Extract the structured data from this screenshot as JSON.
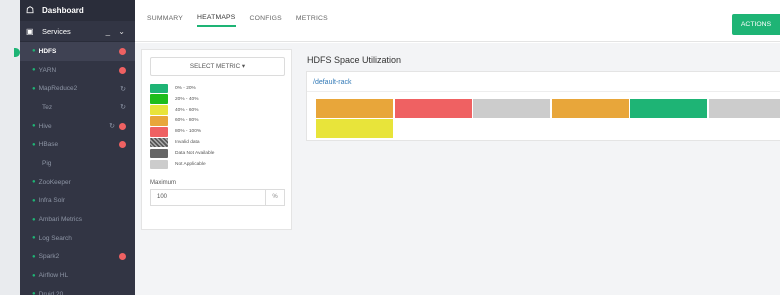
{
  "sidebar": {
    "dashboard": "Dashboard",
    "services": "Services",
    "items": [
      {
        "label": "HDFS",
        "active": true,
        "dot": true,
        "refresh": false,
        "badge": "3"
      },
      {
        "label": "YARN",
        "active": false,
        "dot": true,
        "refresh": false,
        "badge": "1"
      },
      {
        "label": "MapReduce2",
        "active": false,
        "dot": true,
        "refresh": true,
        "badge": ""
      },
      {
        "label": "Tez",
        "active": false,
        "dot": false,
        "refresh": true,
        "badge": ""
      },
      {
        "label": "Hive",
        "active": false,
        "dot": true,
        "refresh": true,
        "badge": "1"
      },
      {
        "label": "HBase",
        "active": false,
        "dot": true,
        "refresh": false,
        "badge": "1"
      },
      {
        "label": "Pig",
        "active": false,
        "dot": false,
        "refresh": false,
        "badge": ""
      },
      {
        "label": "ZooKeeper",
        "active": false,
        "dot": true,
        "refresh": false,
        "badge": ""
      },
      {
        "label": "Infra Solr",
        "active": false,
        "dot": true,
        "refresh": false,
        "badge": ""
      },
      {
        "label": "Ambari Metrics",
        "active": false,
        "dot": true,
        "refresh": false,
        "badge": ""
      },
      {
        "label": "Log Search",
        "active": false,
        "dot": true,
        "refresh": false,
        "badge": ""
      },
      {
        "label": "Spark2",
        "active": false,
        "dot": true,
        "refresh": false,
        "badge": "1"
      },
      {
        "label": "Airflow HL",
        "active": false,
        "dot": true,
        "refresh": false,
        "badge": ""
      },
      {
        "label": "Druid 20",
        "active": false,
        "dot": true,
        "refresh": false,
        "badge": ""
      }
    ]
  },
  "tabs": [
    "SUMMARY",
    "HEATMAPS",
    "CONFIGS",
    "METRICS"
  ],
  "active_tab": "HEATMAPS",
  "actions_label": "ACTIONS",
  "select_metric_label": "SELECT METRIC ▾",
  "legend": [
    {
      "label": "0% - 20%",
      "color": "#1eb475"
    },
    {
      "label": "20% - 40%",
      "color": "#1ebd1b"
    },
    {
      "label": "40% - 60%",
      "color": "#e8e43a"
    },
    {
      "label": "60% - 80%",
      "color": "#e8a63a"
    },
    {
      "label": "80% - 100%",
      "color": "#ef6162"
    },
    {
      "label": "Invalid data",
      "color": "hatch"
    },
    {
      "label": "Data Not Available",
      "color": "#666666"
    },
    {
      "label": "Not Applicable",
      "color": "#cccccc"
    }
  ],
  "maximum": {
    "label": "Maximum",
    "value": "100",
    "unit": "%"
  },
  "heatmap": {
    "title": "HDFS Space Utilization",
    "rack": "/default-rack",
    "cells": [
      "#e8a63a",
      "#ef6162",
      "#cccccc",
      "#e8a63a",
      "#1eb475",
      "#cccccc",
      "#e8e43a"
    ]
  }
}
